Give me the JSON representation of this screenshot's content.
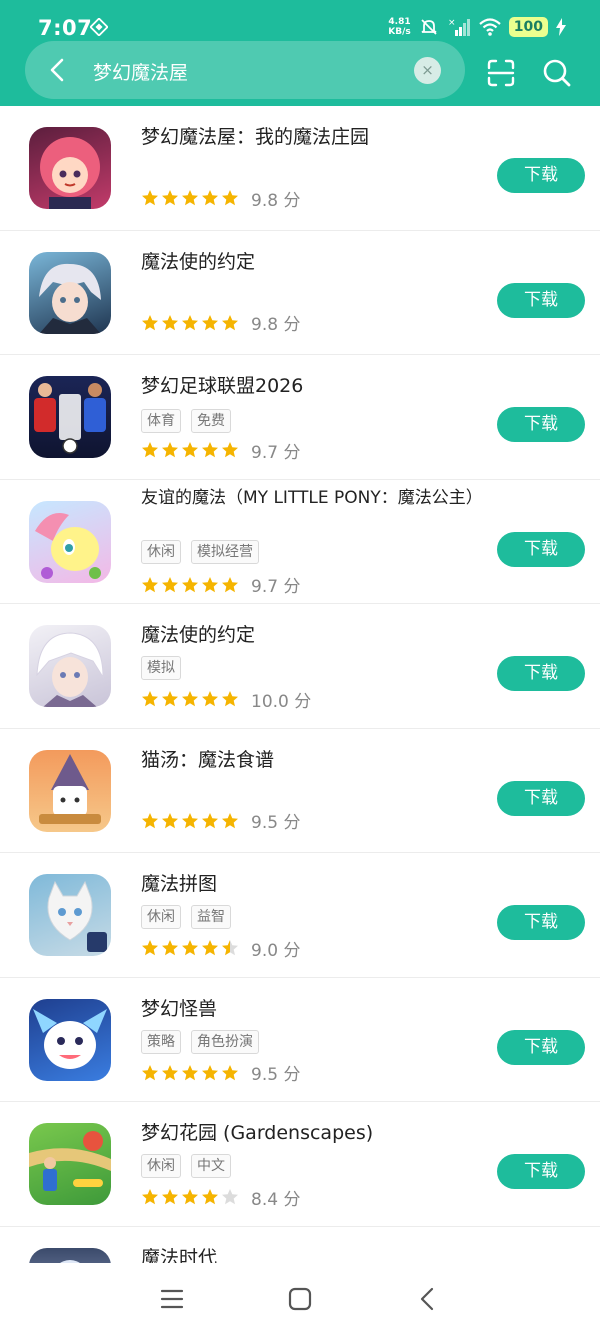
{
  "status": {
    "time": "7:07",
    "net_speed_value": "4.81",
    "net_speed_unit": "KB/s",
    "battery": "100"
  },
  "search": {
    "query": "梦幻魔法屋",
    "clear_symbol": "×"
  },
  "colors": {
    "accent": "#1ebc9c",
    "star": "#f5b400",
    "star_empty": "#dcdcdc"
  },
  "apps": [
    {
      "name": "梦幻魔法屋：我的魔法庄园",
      "tags": [],
      "rating": 5,
      "score": "9.8 分",
      "button": "下载",
      "icon": "princess-avatar-icon"
    },
    {
      "name": "魔法使的约定",
      "tags": [],
      "rating": 5,
      "score": "9.8 分",
      "button": "下载",
      "icon": "silver-hair-boy-icon"
    },
    {
      "name": "梦幻足球联盟2026",
      "tags": [
        "体育",
        "免费"
      ],
      "rating": 5,
      "score": "9.7 分",
      "button": "下载",
      "icon": "soccer-players-icon"
    },
    {
      "name": "友谊的魔法（MY LITTLE PONY：魔法公主）",
      "tags": [
        "休闲",
        "模拟经营"
      ],
      "rating": 5,
      "score": "9.7 分",
      "button": "下载",
      "icon": "pony-icon"
    },
    {
      "name": "魔法使的约定",
      "tags": [
        "模拟"
      ],
      "rating": 5,
      "score": "10.0 分",
      "button": "下载",
      "icon": "white-hair-boy-icon"
    },
    {
      "name": "猫汤：魔法食谱",
      "tags": [],
      "rating": 5,
      "score": "9.5 分",
      "button": "下载",
      "icon": "wizard-cat-icon"
    },
    {
      "name": "魔法拼图",
      "tags": [
        "休闲",
        "益智"
      ],
      "rating": 4.5,
      "score": "9.0 分",
      "button": "下载",
      "icon": "cat-puzzle-icon"
    },
    {
      "name": "梦幻怪兽",
      "tags": [
        "策略",
        "角色扮演"
      ],
      "rating": 5,
      "score": "9.5 分",
      "button": "下载",
      "icon": "monster-icon"
    },
    {
      "name": "梦幻花园 (Gardenscapes)",
      "tags": [
        "休闲",
        "中文"
      ],
      "rating": 4,
      "score": "8.4 分",
      "button": "下载",
      "icon": "garden-icon"
    },
    {
      "name": "魔法时代",
      "tags": [],
      "rating": 0,
      "score": "",
      "button": "",
      "icon": "magic-age-icon"
    }
  ]
}
